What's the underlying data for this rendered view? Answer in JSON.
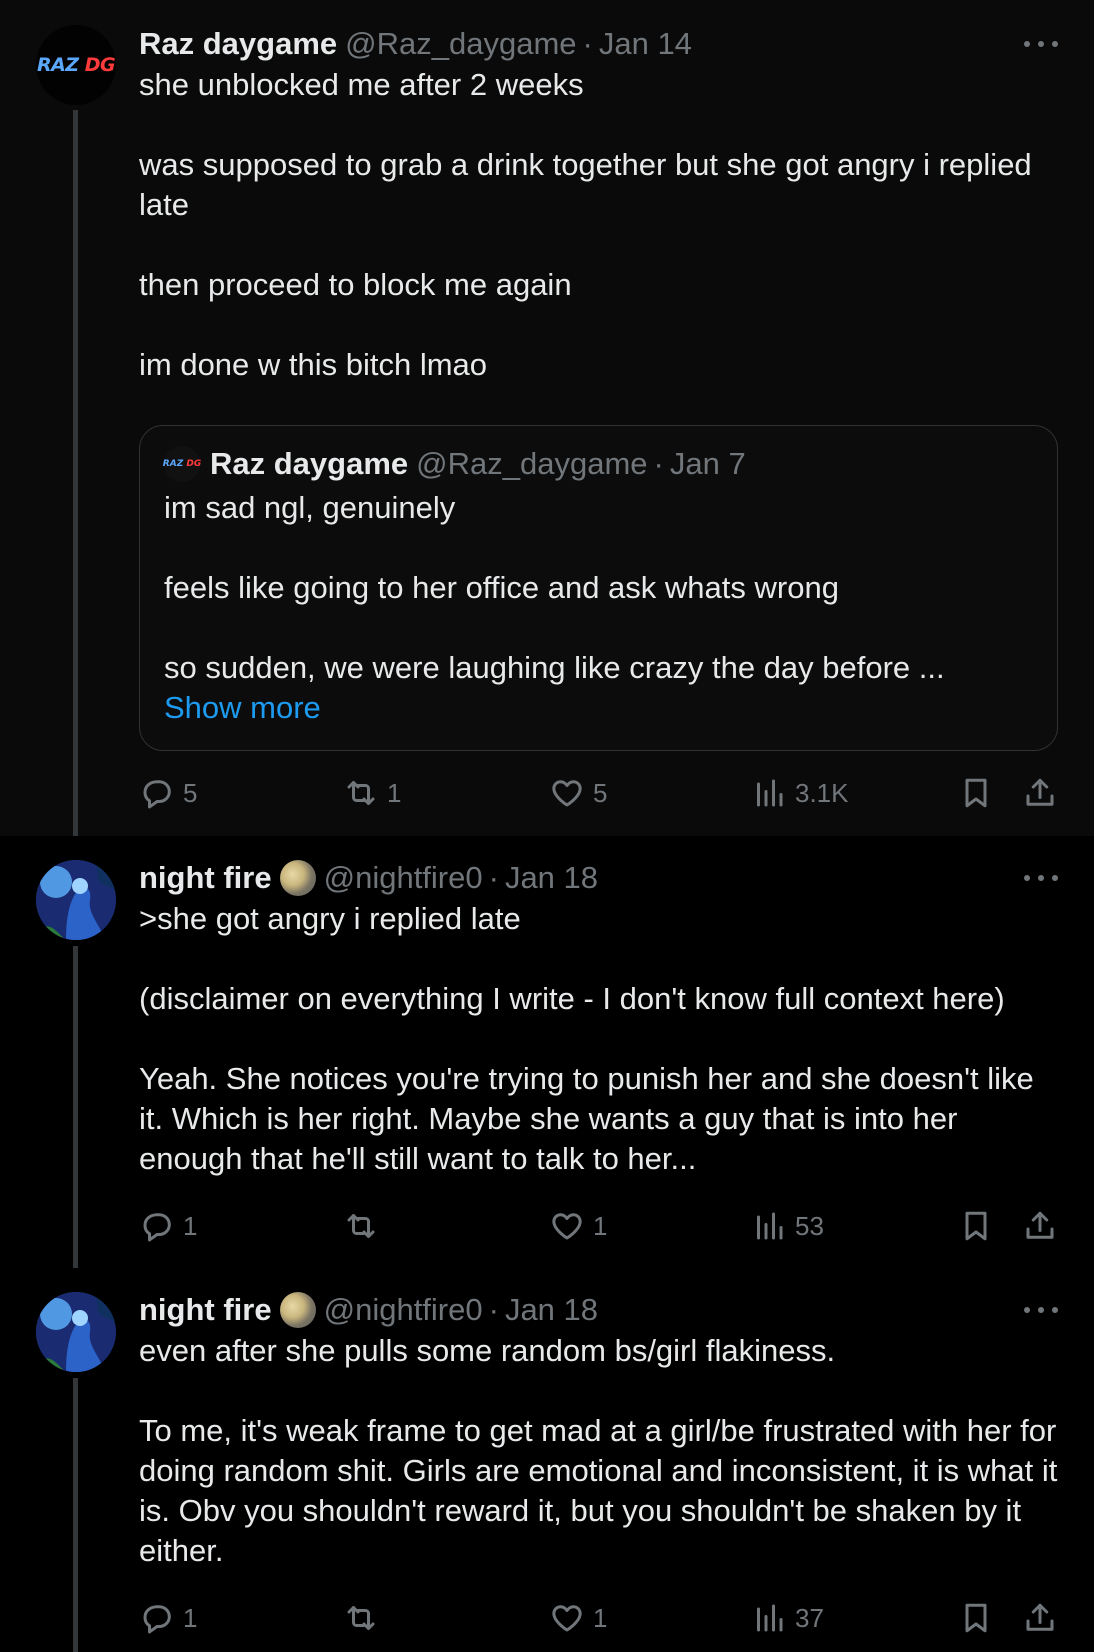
{
  "tweets": [
    {
      "avatar_text_a": "RAZ",
      "avatar_text_b": "DG",
      "name": "Raz daygame",
      "handle": "@Raz_daygame",
      "date": "Jan 14",
      "body": [
        "she unblocked me after 2 weeks",
        "was supposed to grab a drink together but she got angry i replied late",
        "then proceed to block me again",
        "im done w this bitch lmao"
      ],
      "quote": {
        "avatar_text_a": "RAZ",
        "avatar_text_b": "DG",
        "name": "Raz daygame",
        "handle": "@Raz_daygame",
        "date": "Jan 7",
        "body": [
          "im sad ngl, genuinely",
          "feels like going to her office and ask whats wrong",
          "so sudden, we were laughing like crazy the day before ..."
        ],
        "show_more": "Show more"
      },
      "stats": {
        "replies": "5",
        "retweets": "1",
        "likes": "5",
        "views": "3.1K"
      }
    },
    {
      "name": "night fire",
      "handle": "@nightfire0",
      "date": "Jan 18",
      "body": [
        ">she got angry i replied late",
        "(disclaimer on everything I write - I don't know full context here)",
        "Yeah. She notices you're trying to punish her and she doesn't like it. Which is her right. Maybe she wants a guy that is into her enough that he'll still want to talk to her..."
      ],
      "stats": {
        "replies": "1",
        "retweets": "",
        "likes": "1",
        "views": "53"
      }
    },
    {
      "name": "night fire",
      "handle": "@nightfire0",
      "date": "Jan 18",
      "body": [
        "even after she pulls some random bs/girl flakiness.",
        "To me, it's weak frame to get mad at a girl/be frustrated with her for doing random shit. Girls are emotional and inconsistent, it is what it is. Obv you shouldn't reward it, but you shouldn't be shaken by it either."
      ],
      "stats": {
        "replies": "1",
        "retweets": "",
        "likes": "1",
        "views": "37"
      }
    }
  ],
  "header_separator": "·",
  "icons": [
    "reply-icon",
    "retweet-icon",
    "like-icon",
    "views-icon",
    "bookmark-icon",
    "share-icon",
    "more-icon"
  ],
  "colors": {
    "background": "#000000",
    "text": "#e7e9ea",
    "muted": "#71767b",
    "link": "#1d9bf0",
    "border": "#2f3336"
  }
}
